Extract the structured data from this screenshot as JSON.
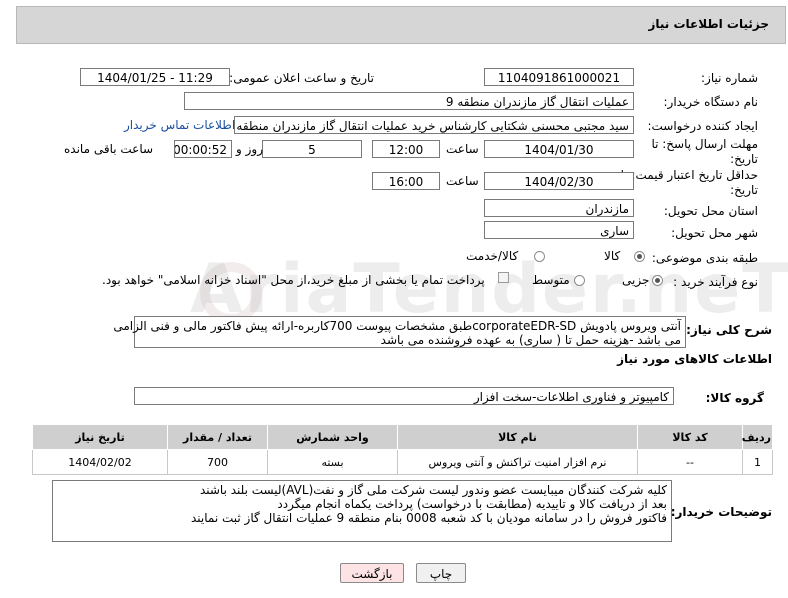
{
  "header": {
    "title": "جزئیات اطلاعات نیاز"
  },
  "fields": {
    "need_number_label": "شماره نیاز:",
    "need_number": "1104091861000021",
    "announce_label": "تاریخ و ساعت اعلان عمومی:",
    "announce_value": "1404/01/25 - 11:29",
    "buyer_org_label": "نام دستگاه خریدار:",
    "buyer_org": "عملیات انتقال گاز مازندران منطقه 9",
    "requester_label": "ایجاد کننده درخواست:",
    "requester": "سید مجتبی محسنی شکتایی کارشناس خرید عملیات انتقال گاز مازندران منطقه 9",
    "contact_link": "اطلاعات تماس خریدار",
    "deadline_label": "مهلت ارسال پاسخ: تا تاریخ:",
    "deadline_date": "1404/01/30",
    "time_label": "ساعت",
    "deadline_time": "12:00",
    "days_value": "5",
    "days_label": "روز و",
    "remaining_time": "00:00:52",
    "remaining_label": "ساعت باقی مانده",
    "validity_label": "حداقل تاریخ اعتبار قیمت: تا تاریخ:",
    "validity_date": "1404/02/30",
    "validity_time": "16:00",
    "province_label": "استان محل تحویل:",
    "province": "مازندران",
    "city_label": "شهر محل تحویل:",
    "city": "ساری",
    "category_label": "طبقه بندی موضوعی:",
    "category_options": [
      "کالا",
      "کالا/خدمت"
    ],
    "process_label": "نوع فرآیند خرید :",
    "process_options": [
      "جزیی",
      "متوسط"
    ],
    "payment_note": "پرداخت تمام یا بخشی از مبلغ خرید،از محل \"اسناد خزانه اسلامی\" خواهد بود.",
    "desc_label": "شرح کلی نیاز:",
    "desc_line1": "آنتی ویروس پادویش corporateEDR-SDطبق مشخصات پیوست 700کاربره-ارائه پیش فاکتور مالی و فنی الزامی",
    "desc_line2": "می باشد -هزینه حمل تا ( ساری) به عهده فروشنده می باشد",
    "goods_info_title": "اطلاعات کالاهای مورد نیاز",
    "goods_group_label": "گروه کالا:",
    "goods_group": "کامپیوتر و فناوری اطلاعات-سخت افزار"
  },
  "table": {
    "headers": [
      "ردیف",
      "کد کالا",
      "نام کالا",
      "واحد شمارش",
      "تعداد / مقدار",
      "تاریخ نیاز"
    ],
    "rows": [
      [
        "1",
        "--",
        "نرم افزار امنیت تراکنش و آنتی ویروس",
        "بسته",
        "700",
        "1404/02/02"
      ]
    ]
  },
  "buyer_notes": {
    "label": "توضیحات خریدار:",
    "line1": "کلیه شرکت کنندگان میبایست عضو وندور لیست شرکت ملی گاز و نفت(AVL)لیست بلند باشند",
    "line2": "بعد از دریافت کالا و تاییدیه (مطابقت با درخواست) پرداخت یکماه انجام میگردد",
    "line3": "فاکتور فروش را در سامانه مودیان با کد شعبه 0008 بنام منطقه 9 عملیات انتقال گاز ثبت نمایند"
  },
  "buttons": {
    "print": "چاپ",
    "back": "بازگشت"
  },
  "watermark": "AriaTender.neT",
  "colors": {
    "header_bg": "#d6d6d6",
    "table_header_bg": "#cfcfcf",
    "back_button_bg": "#fde3e3",
    "link": "#1a4fa0"
  }
}
